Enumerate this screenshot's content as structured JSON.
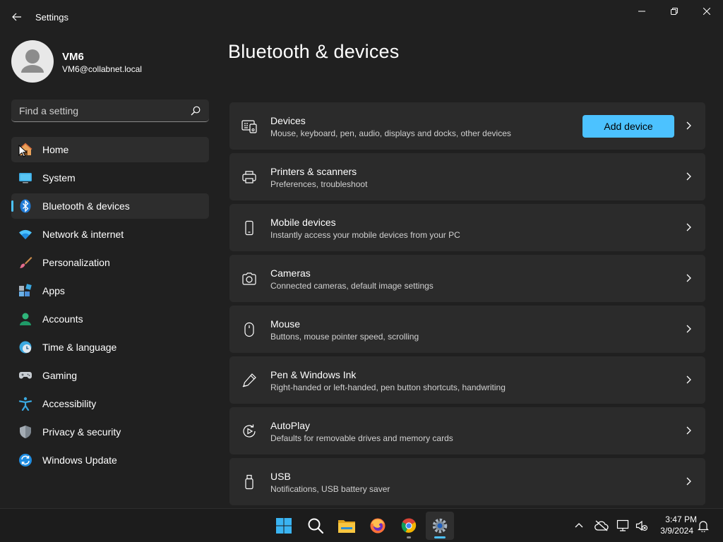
{
  "window": {
    "app_title": "Settings"
  },
  "profile": {
    "name": "VM6",
    "email": "VM6@collabnet.local"
  },
  "search": {
    "placeholder": "Find a setting"
  },
  "nav": {
    "items": [
      {
        "label": "Home",
        "icon": "home-icon"
      },
      {
        "label": "System",
        "icon": "monitor-icon"
      },
      {
        "label": "Bluetooth & devices",
        "icon": "bluetooth-icon"
      },
      {
        "label": "Network & internet",
        "icon": "wifi-icon"
      },
      {
        "label": "Personalization",
        "icon": "paintbrush-icon"
      },
      {
        "label": "Apps",
        "icon": "apps-icon"
      },
      {
        "label": "Accounts",
        "icon": "person-icon"
      },
      {
        "label": "Time & language",
        "icon": "clock-globe-icon"
      },
      {
        "label": "Gaming",
        "icon": "gamepad-icon"
      },
      {
        "label": "Accessibility",
        "icon": "accessibility-icon"
      },
      {
        "label": "Privacy & security",
        "icon": "shield-icon"
      },
      {
        "label": "Windows Update",
        "icon": "update-icon"
      }
    ],
    "active_index": 2
  },
  "main": {
    "title": "Bluetooth & devices",
    "add_device_label": "Add device",
    "cards": [
      {
        "title": "Devices",
        "subtitle": "Mouse, keyboard, pen, audio, displays and docks, other devices",
        "icon": "devices-icon"
      },
      {
        "title": "Printers & scanners",
        "subtitle": "Preferences, troubleshoot",
        "icon": "printer-icon"
      },
      {
        "title": "Mobile devices",
        "subtitle": "Instantly access your mobile devices from your PC",
        "icon": "phone-icon"
      },
      {
        "title": "Cameras",
        "subtitle": "Connected cameras, default image settings",
        "icon": "camera-icon"
      },
      {
        "title": "Mouse",
        "subtitle": "Buttons, mouse pointer speed, scrolling",
        "icon": "mouse-icon"
      },
      {
        "title": "Pen & Windows Ink",
        "subtitle": "Right-handed or left-handed, pen button shortcuts, handwriting",
        "icon": "pen-icon"
      },
      {
        "title": "AutoPlay",
        "subtitle": "Defaults for removable drives and memory cards",
        "icon": "autoplay-icon"
      },
      {
        "title": "USB",
        "subtitle": "Notifications, USB battery saver",
        "icon": "usb-icon"
      }
    ]
  },
  "taskbar": {
    "apps": [
      "start-icon",
      "search-icon",
      "file-explorer-icon",
      "firefox-icon",
      "chrome-icon",
      "settings-icon"
    ],
    "time": "3:47 PM",
    "date": "3/9/2024"
  },
  "colors": {
    "accent": "#4cc2ff",
    "background": "#202020",
    "card": "#2b2b2b"
  }
}
